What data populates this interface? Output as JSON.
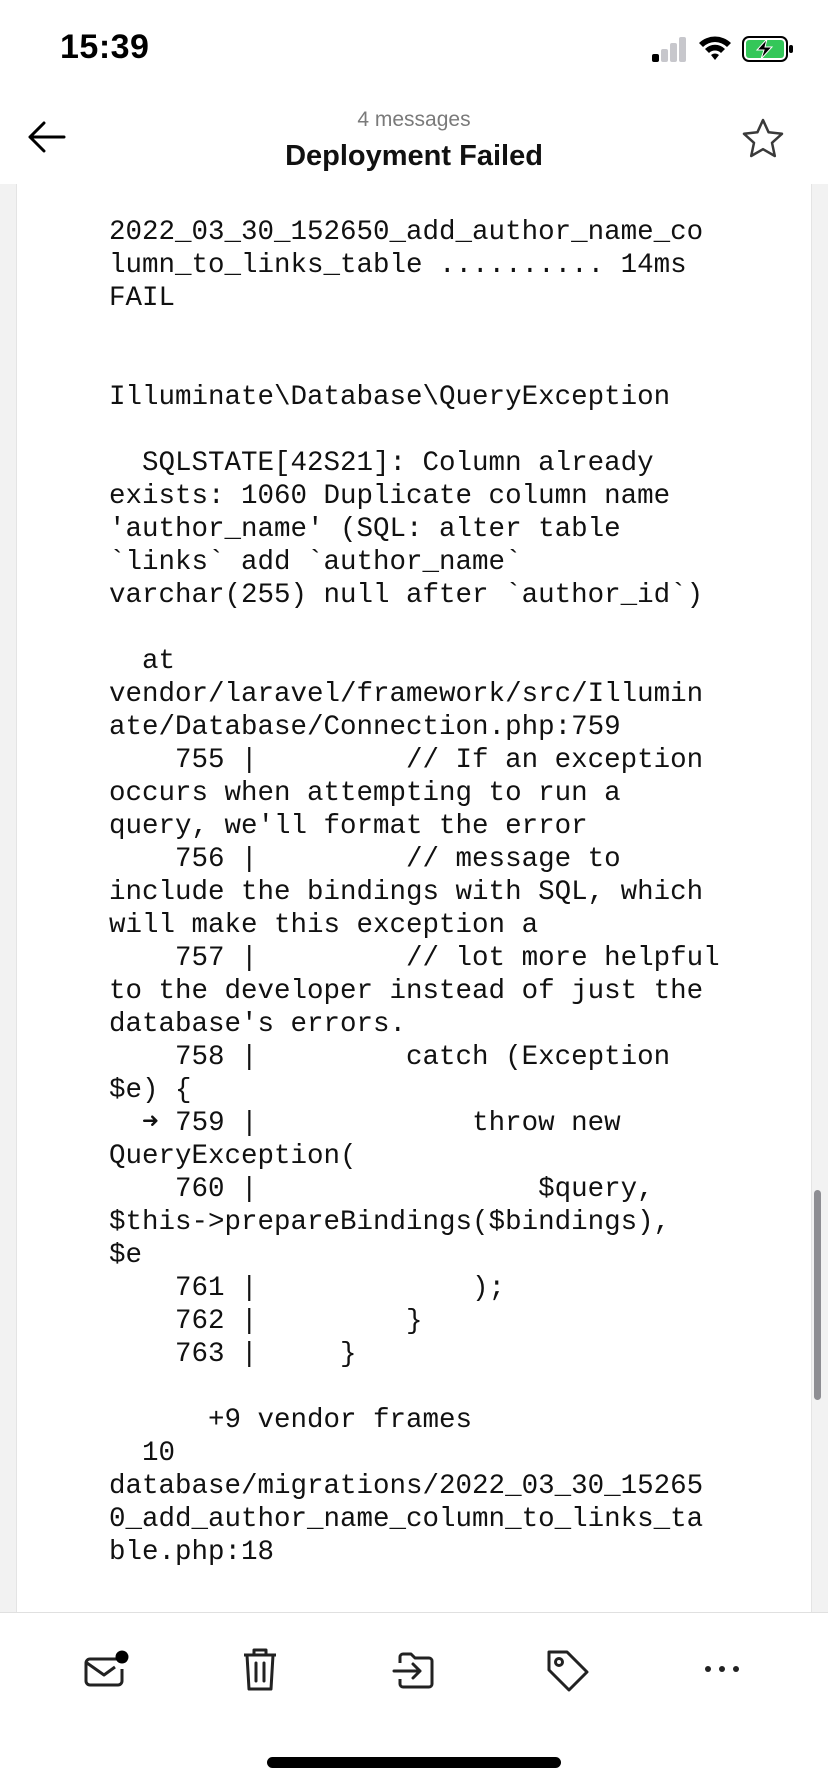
{
  "status_bar": {
    "time": "15:39"
  },
  "header": {
    "message_count": "4 messages",
    "title": "Deployment Failed"
  },
  "email_body": {
    "lines": [
      "2022_03_30_152650_add_author_name_co",
      "lumn_to_links_table .......... 14ms",
      "FAIL",
      "",
      "",
      "Illuminate\\Database\\QueryException",
      "",
      "  SQLSTATE[42S21]: Column already",
      "exists: 1060 Duplicate column name",
      "'author_name' (SQL: alter table",
      "`links` add `author_name`",
      "varchar(255) null after `author_id`)",
      "",
      "  at",
      "vendor/laravel/framework/src/Illumin",
      "ate/Database/Connection.php:759",
      "    755 |         // If an exception",
      "occurs when attempting to run a",
      "query, we'll format the error",
      "    756 |         // message to",
      "include the bindings with SQL, which",
      "will make this exception a",
      "    757 |         // lot more helpful",
      "to the developer instead of just the",
      "database's errors.",
      "    758 |         catch (Exception",
      "$e) {",
      "  ➜ 759 |             throw new",
      "QueryException(",
      "    760 |                 $query,",
      "$this->prepareBindings($bindings),",
      "$e",
      "    761 |             );",
      "    762 |         }",
      "    763 |     }",
      "",
      "      +9 vendor frames",
      "  10",
      "database/migrations/2022_03_30_15265",
      "0_add_author_name_column_to_links_ta",
      "ble.php:18"
    ]
  },
  "icons": {
    "back": "arrow-left-icon",
    "star": "star-icon",
    "mark_unread": "mail-unread-icon",
    "delete": "trash-icon",
    "move": "move-to-folder-icon",
    "label": "tag-icon",
    "more": "more-horizontal-icon"
  },
  "colors": {
    "battery_charging": "#34c759",
    "signal_inactive": "#c7c7cc"
  }
}
